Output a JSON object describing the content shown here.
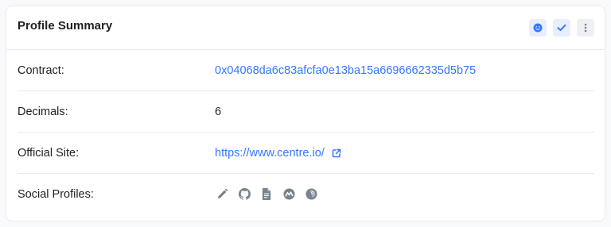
{
  "card": {
    "title": "Profile Summary",
    "actions": [
      {
        "icon": "smiley-icon",
        "color": "#3377ff"
      },
      {
        "icon": "check-icon",
        "color": "#3377ff"
      },
      {
        "icon": "more-vertical-icon",
        "color": "#77838f"
      }
    ]
  },
  "rows": {
    "contract": {
      "label": "Contract:",
      "value": "0x04068da6c83afcfa0e13ba15a6696662335d5b75"
    },
    "decimals": {
      "label": "Decimals:",
      "value": "6"
    },
    "site": {
      "label": "Official Site:",
      "value": "https://www.centre.io/"
    },
    "social": {
      "label": "Social Profiles:",
      "icons": [
        "pencil-icon",
        "github-icon",
        "document-icon",
        "coinmarketcap-icon",
        "coingecko-icon"
      ]
    }
  },
  "colors": {
    "link": "#3377ff",
    "text": "#1e2022",
    "muted_icon": "#77838f",
    "border": "#e7eaf3"
  }
}
